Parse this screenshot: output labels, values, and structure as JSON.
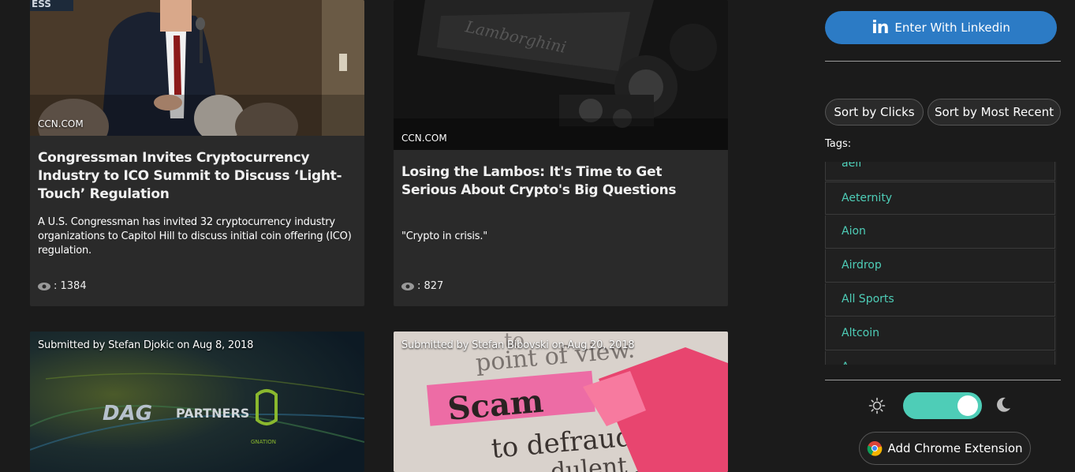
{
  "cards": [
    {
      "source": "CCN.COM",
      "title": "Congressman Invites Cryptocurrency Industry to ICO Summit to Discuss ‘Light-Touch’ Regulation",
      "description": "A U.S. Congressman has invited 32 cryptocurrency industry organizations to Capitol Hill to discuss initial coin offering (ICO) regulation.",
      "views": ": 1384",
      "image_banner": "ESS"
    },
    {
      "source": "CCN.COM",
      "title": "Losing the Lambos: It's Time to Get Serious About Crypto's Big Questions",
      "description": "\"Crypto in crisis.\"",
      "views": ": 827"
    },
    {
      "submitted": "Submitted by Stefan Djokic on Aug 8, 2018",
      "image_text": "PARTNERS",
      "logo_text": "GNATION"
    },
    {
      "submitted": "Submitted by Stefan Bibovski on Aug 20, 2018",
      "image_words": [
        "to",
        "point of view.",
        "Scam",
        "to defraud a",
        "dulent b"
      ]
    }
  ],
  "sidebar": {
    "linkedin_label": "Enter With Linkedin",
    "sort_clicks": "Sort by Clicks",
    "sort_recent": "Sort by Most Recent",
    "tags_label": "Tags:",
    "tags": [
      "aelf",
      "Aeternity",
      "Aion",
      "Airdrop",
      "All Sports",
      "Altcoin",
      "A"
    ],
    "chrome_label": "Add Chrome Extension",
    "theme_toggle_on": true
  },
  "colors": {
    "accent_teal": "#4ecdb7",
    "linkedin_blue": "#2c7bc5",
    "background": "#1b1b1b",
    "card": "#2a2a2a"
  }
}
